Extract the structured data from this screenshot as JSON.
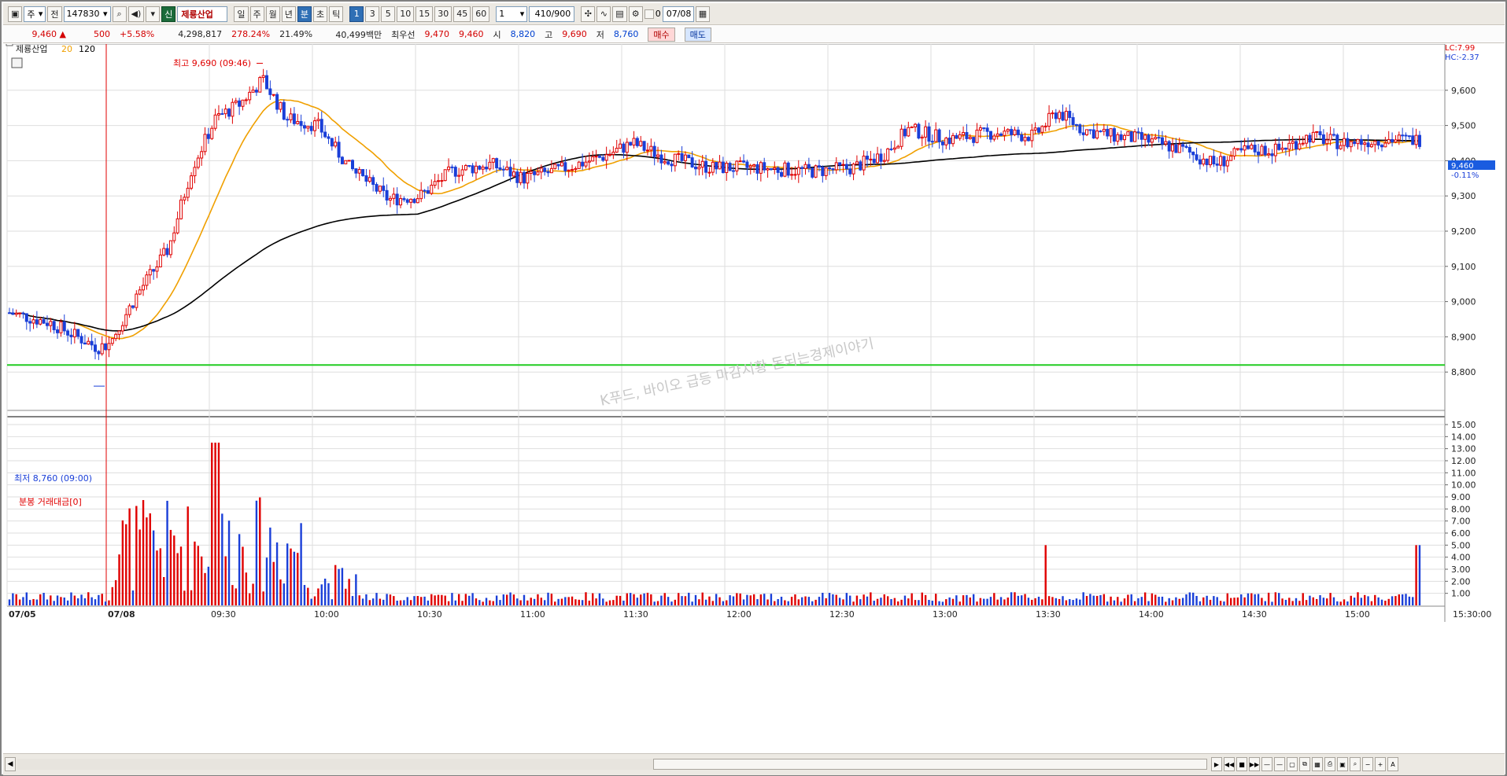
{
  "toolbar": {
    "market": "주",
    "prefix": "전",
    "code": "147830",
    "badge": "신",
    "name": "제룡산업",
    "periods": [
      "일",
      "주",
      "월",
      "년",
      "분",
      "초",
      "틱"
    ],
    "minutes": [
      "1",
      "3",
      "5",
      "10",
      "15",
      "30",
      "45",
      "60"
    ],
    "multiplier": "1",
    "count": "410",
    "count_max": "/900",
    "checkbox_label": "0",
    "date": "07/08"
  },
  "quote": {
    "price": "9,460",
    "arrow": "▲",
    "change": "500",
    "change_pct": "+5.58%",
    "volume": "4,298,817",
    "volume_ratio": "278.24%",
    "turnover": "21.49%",
    "amount": "40,499백만",
    "best_label": "최우선",
    "best_ask": "9,470",
    "best_bid": "9,460",
    "open_label": "시",
    "open": "8,820",
    "high_label": "고",
    "high": "9,690",
    "low_label": "저",
    "low": "8,760",
    "buy_label": "매수",
    "sell_label": "매도"
  },
  "panel_price": {
    "title": "제룡산업",
    "ma_short_label": "20",
    "ma_long_label": "120",
    "lc_label": "LC:7.99",
    "hc_label": "HC:-2.37",
    "high_marker": "최고 9,690 (09:46)",
    "low_marker": "최저 8,760 (09:00)",
    "watermark": "K푸드, 바이오 급등 마감시황  돈되는경제이야기",
    "price_tag": "9,460",
    "price_pct_tag": "-0.11%"
  },
  "panel_volume": {
    "title": "분봉 거래대금[0]"
  },
  "colors": {
    "up": "#e00000",
    "down": "#1a3fd8",
    "ma20": "#f0a000",
    "ma120": "#000000",
    "support": "#22cc22",
    "grid": "#dedede"
  },
  "chart_data": [
    {
      "type": "candlestick",
      "title": "제룡산업",
      "ylim": [
        8700,
        9700
      ],
      "yticks": [
        "9,600",
        "9,500",
        "9,400",
        "9,300",
        "9,200",
        "9,100",
        "9,000",
        "8,900",
        "8,800"
      ],
      "xticks": [
        "07/05",
        "07/08",
        "09:30",
        "10:00",
        "10:30",
        "11:00",
        "11:30",
        "12:00",
        "12:30",
        "13:00",
        "13:30",
        "14:00",
        "14:30",
        "15:00",
        "15:30:00"
      ],
      "support_line": 8820,
      "high": {
        "time": "09:46",
        "value": 9690
      },
      "low": {
        "time": "09:00",
        "value": 8760
      },
      "last": 9460,
      "series": [
        {
          "name": "20",
          "type": "line"
        },
        {
          "name": "120",
          "type": "line"
        }
      ]
    },
    {
      "type": "bar",
      "title": "분봉 거래대금[0]",
      "ylim": [
        0,
        15
      ],
      "yticks": [
        "15.00",
        "14.00",
        "13.00",
        "12.00",
        "11.00",
        "10.00",
        "9.00",
        "8.00",
        "7.00",
        "6.00",
        "5.00",
        "4.00",
        "3.00",
        "2.00",
        "1.00"
      ]
    }
  ]
}
